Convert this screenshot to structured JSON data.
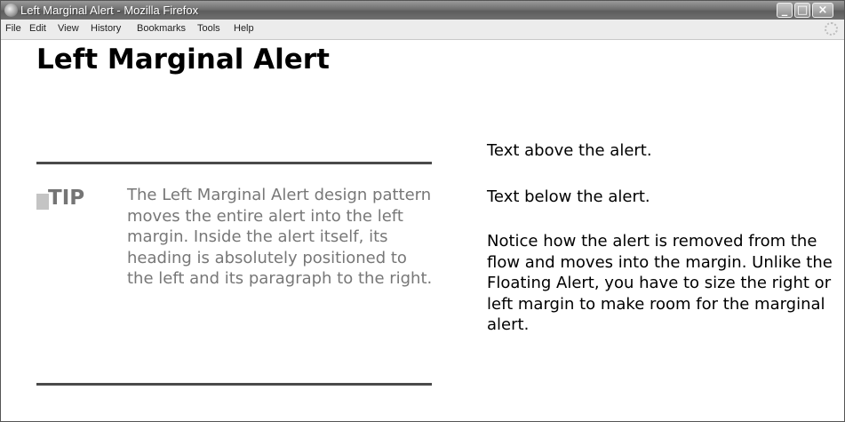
{
  "window": {
    "title": "Left Marginal Alert - Mozilla Firefox",
    "controls": {
      "minimize": "_",
      "maximize": "□",
      "close": "×"
    }
  },
  "menu": {
    "items": [
      "File",
      "Edit",
      "View",
      "History",
      "Bookmarks",
      "Tools",
      "Help"
    ]
  },
  "page": {
    "heading": "Left Marginal Alert",
    "text_above": "Text above the alert.",
    "text_below": "Text below the alert.",
    "notice": "Notice how the alert is removed from the flow and moves into the margin. Unlike the Floating Alert, you have to size the right or left margin to make room for the marginal alert.",
    "alert": {
      "heading": "TIP",
      "text": "The Left Marginal Alert design pattern moves the entire alert into the left margin. Inside the alert itself, its heading is absolutely positioned to the left and its paragraph to the right."
    }
  }
}
